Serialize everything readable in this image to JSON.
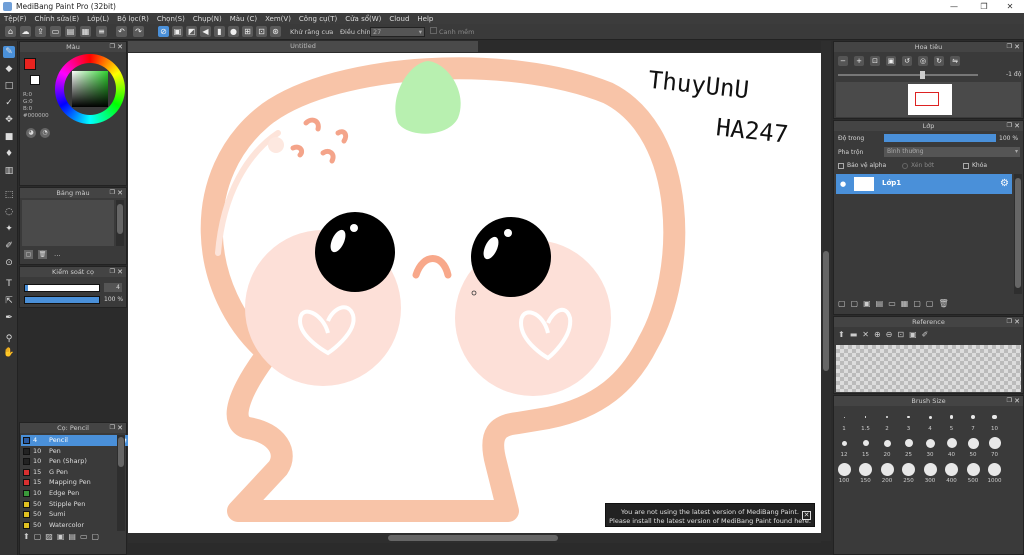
{
  "app": {
    "title": "MediBang Paint Pro (32bit)",
    "min": "—",
    "restore": "❐",
    "close": "✕"
  },
  "menu": [
    "Tệp(F)",
    "Chỉnh sửa(E)",
    "Lớp(L)",
    "Bộ lọc(R)",
    "Chọn(S)",
    "Chụp(N)",
    "Màu (C)",
    "Xem(V)",
    "Công cụ(T)",
    "Cửa sổ(W)",
    "Cloud",
    "Help"
  ],
  "toolbar": {
    "antialias_label": "Khử răng cưa",
    "adjust_label": "Điều chỉnh",
    "adjust_value": "27",
    "edge_label": "Canh mềm"
  },
  "document": {
    "tab": "Untitled"
  },
  "color_panel": {
    "title": "Màu",
    "r": "R:0",
    "g": "G:0",
    "b": "B:0",
    "hex": "#000000",
    "fg": "#e8231f",
    "bg": "#ffffff"
  },
  "palette_panel": {
    "title": "Bảng màu",
    "more": "..."
  },
  "brush_control": {
    "title": "Kiểm soát cọ",
    "size_value": "4",
    "opacity_value": "100 %"
  },
  "brush_panel": {
    "title": "Cọ: Pencil",
    "items": [
      {
        "size": "4",
        "name": "Pencil",
        "color": "#2a5aa0"
      },
      {
        "size": "10",
        "name": "Pen",
        "color": "#222222"
      },
      {
        "size": "10",
        "name": "Pen (Sharp)",
        "color": "#222222"
      },
      {
        "size": "15",
        "name": "G Pen",
        "color": "#d83030"
      },
      {
        "size": "15",
        "name": "Mapping Pen",
        "color": "#d83030"
      },
      {
        "size": "10",
        "name": "Edge Pen",
        "color": "#3a9a3a"
      },
      {
        "size": "50",
        "name": "Stipple Pen",
        "color": "#e0c020"
      },
      {
        "size": "50",
        "name": "Sumi",
        "color": "#e0c020"
      },
      {
        "size": "50",
        "name": "Watercolor",
        "color": "#e0c020"
      }
    ]
  },
  "navigator": {
    "title": "Hoa tiêu",
    "rotation": "-1 độ"
  },
  "layer_panel": {
    "title": "Lớp",
    "opacity_label": "Độ trong",
    "opacity_value": "100 %",
    "blend_label": "Pha trộn",
    "blend_value": "Bình thường",
    "protect_alpha": "Bảo vệ alpha",
    "clipping": "Xén bớt",
    "lock": "Khóa",
    "layer_name": "Lớp1"
  },
  "reference_panel": {
    "title": "Reference"
  },
  "brush_size_panel": {
    "title": "Brush Size",
    "row1": [
      "1",
      "1.5",
      "2",
      "3",
      "4",
      "5",
      "7",
      "10"
    ],
    "row2": [
      "12",
      "15",
      "20",
      "25",
      "30",
      "40",
      "50",
      "70"
    ],
    "row3": [
      "100",
      "150",
      "200",
      "250",
      "300",
      "400",
      "500",
      "1000"
    ]
  },
  "canvas_text": {
    "line1": "ThuyUnU",
    "line2": "HA247"
  },
  "notice": {
    "line1": "You are not using the latest version of MediBang Paint.",
    "line2": "Please install the latest version of MediBang Paint found here.",
    "close": "✕"
  },
  "colors": {
    "accent": "#4a90d9",
    "peach": "#f8c4a8",
    "blush": "#fde0d8",
    "leaf": "#b8f0b0"
  }
}
